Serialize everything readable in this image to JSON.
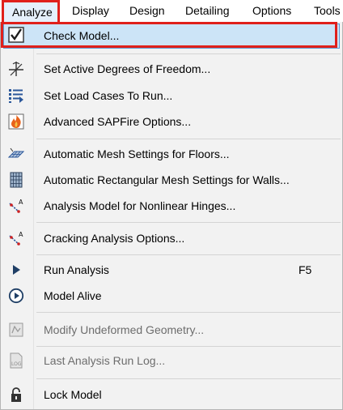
{
  "menubar": {
    "items": [
      "Analyze",
      "Display",
      "Design",
      "Detailing",
      "Options",
      "Tools"
    ]
  },
  "menu": {
    "items": [
      {
        "label": "Check Model...",
        "icon": "check-model-icon"
      },
      {
        "label": "Set Active Degrees of Freedom...",
        "icon": "degrees-of-freedom-icon"
      },
      {
        "label": "Set Load Cases To Run...",
        "icon": "load-cases-icon"
      },
      {
        "label": "Advanced SAPFire Options...",
        "icon": "sapfire-icon"
      },
      {
        "label": "Automatic Mesh Settings for Floors...",
        "icon": "floor-mesh-icon"
      },
      {
        "label": "Automatic Rectangular Mesh Settings for Walls...",
        "icon": "wall-mesh-icon"
      },
      {
        "label": "Analysis Model for Nonlinear Hinges...",
        "icon": "nonlinear-hinges-icon"
      },
      {
        "label": "Cracking Analysis Options...",
        "icon": "cracking-analysis-icon"
      },
      {
        "label": "Run Analysis",
        "shortcut": "F5",
        "icon": "run-analysis-icon"
      },
      {
        "label": "Model Alive",
        "icon": "model-alive-icon"
      },
      {
        "label": "Modify Undeformed Geometry...",
        "icon": "undeformed-geometry-icon"
      },
      {
        "label": "Last Analysis Run Log...",
        "icon": "analysis-log-icon"
      },
      {
        "label": "Lock Model",
        "icon": "lock-icon"
      }
    ]
  },
  "colors": {
    "highlight_frame": "#e0201b",
    "hover_fill": "#cce4f7",
    "menu_background": "#f2f2f2"
  }
}
